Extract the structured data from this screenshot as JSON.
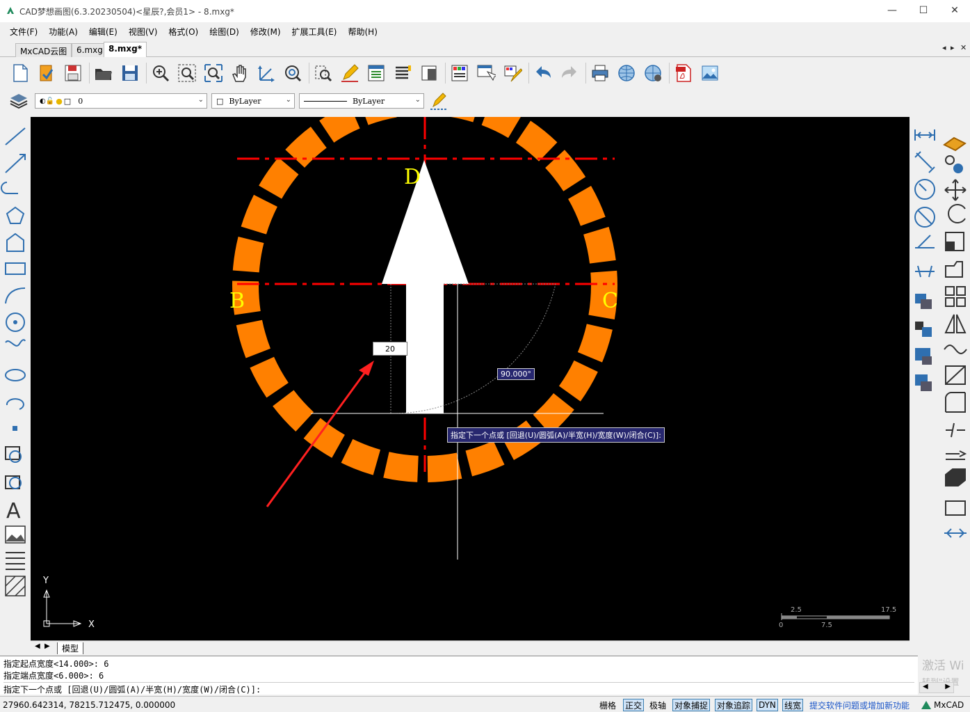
{
  "window": {
    "title": "CAD梦想画图(6.3.20230504)<星辰?,会员1> - 8.mxg*",
    "minimize_icon": "minimize-icon",
    "maximize_icon": "maximize-icon",
    "close_icon": "close-icon"
  },
  "menu": [
    "文件(F)",
    "功能(A)",
    "编辑(E)",
    "视图(V)",
    "格式(O)",
    "绘图(D)",
    "修改(M)",
    "扩展工具(E)",
    "帮助(H)"
  ],
  "tabs": [
    {
      "label": "MxCAD云图"
    },
    {
      "label": "6.mxg"
    },
    {
      "label": "8.mxg*",
      "active": true
    }
  ],
  "tab_controls": {
    "prev": "◂",
    "next": "▸",
    "close": "✕"
  },
  "layer_bar": {
    "layer_value": "0",
    "color_value": "ByLayer",
    "linetype_value": "ByLayer"
  },
  "drawing": {
    "labels": {
      "top": "D",
      "left": "B",
      "right": "C"
    },
    "width_input": "20",
    "angle_tooltip": "90.000°",
    "prompt_tooltip": "指定下一个点或 [回退(U)/圆弧(A)/半宽(H)/宽度(W)/闭合(C)]:",
    "ucs_x": "X",
    "ucs_y": "Y",
    "scale": {
      "a": "2.5",
      "b": "17.5",
      "c": "0",
      "d": "7.5"
    },
    "colors": {
      "ring": "#ff8000",
      "centerline": "#ff0000",
      "label": "#ffff00",
      "arrow": "#ffffff",
      "pointer": "#ff2020"
    }
  },
  "model_tab": "模型",
  "command_history": [
    "指定起点宽度<14.000>: 6",
    "指定端点宽度<6.000>: 6",
    "指定下一个点或 [回退(U)/圆弧(A)/半宽(H)/宽度(W)/闭合(C)]:"
  ],
  "watermark": {
    "line1": "激活 Wi",
    "line2": "转到\"设置"
  },
  "status": {
    "coords": "27960.642314,  78215.712475,  0.000000",
    "toggles": [
      {
        "label": "栅格",
        "on": false,
        "boxed": false
      },
      {
        "label": "正交",
        "on": true,
        "boxed": true
      },
      {
        "label": "极轴",
        "on": false,
        "boxed": false
      },
      {
        "label": "对象捕捉",
        "on": true,
        "boxed": true
      },
      {
        "label": "对象追踪",
        "on": true,
        "boxed": true
      },
      {
        "label": "DYN",
        "on": true,
        "boxed": true
      },
      {
        "label": "线宽",
        "on": true,
        "boxed": true
      }
    ],
    "feedback_link": "提交软件问题或增加新功能",
    "brand": "MxCAD"
  }
}
